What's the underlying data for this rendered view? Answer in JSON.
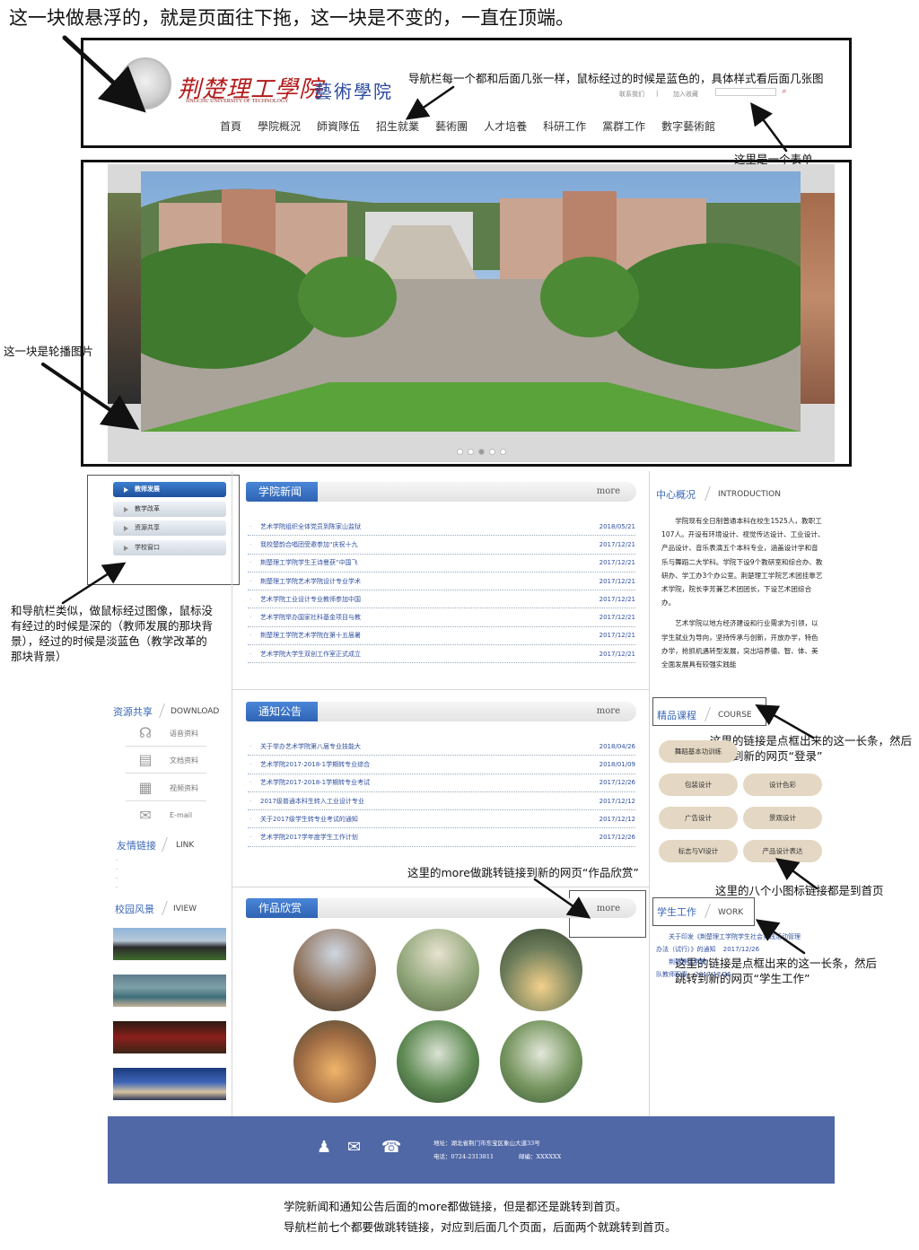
{
  "notes": {
    "top": "这一块做悬浮的，就是页面往下拖，这一块是不变的，一直在顶端。",
    "nav": "导航栏每一个都和后面几张一样，鼠标经过的时候是蓝色的，具体样式看后面几张图",
    "form": "这里是一个表单",
    "carousel": "这一块是轮播图片",
    "leftmenu": "和导航栏类似，做鼠标经过图像，鼠标没有经过的时候是深的（教师发展的那块背景），经过的时候是淡蓝色（教学改革的那块背景）",
    "course": "这里的链接是点框出来的这一长条，然后跳转到新的网页“登录”",
    "works": "这里的more做跳转链接到新的网页“作品欣赏”",
    "icons8": "这里的八个小图标链接都是到首页",
    "work": "这里的链接是点框出来的这一长条，然后跳转到新的网页“学生工作”",
    "bottom1": "学院新闻和通知公告后面的more都做链接，但是都还是跳转到首页。",
    "bottom2": "导航栏前七个都要做跳转链接，对应到后面几个页面，后面两个就跳转到首页。"
  },
  "header": {
    "logo_cn": "荆楚理工學院",
    "logo_en": "JINGCHU UNIVERSITY OF TECHNOLOGY",
    "school": "藝術學院",
    "link_contact": "联系我们",
    "link_fav": "加入收藏",
    "search_placeholder": ""
  },
  "nav": [
    "首頁",
    "學院概況",
    "師資隊伍",
    "招生就業",
    "藝術團",
    "人才培養",
    "科研工作",
    "黨群工作",
    "數字藝術館"
  ],
  "leftmenu": [
    "教师发展",
    "教学改革",
    "资源共享",
    "学校窗口"
  ],
  "news": {
    "title": "学院新闻",
    "more": "more",
    "items": [
      {
        "t": "艺术学院组织全体党员到陈家山监狱",
        "d": "2018/05/21"
      },
      {
        "t": "我校楚韵合唱团受邀参加“庆祝十九",
        "d": "2017/12/21"
      },
      {
        "t": "荆楚理工学院学生王诗曼获“中国飞",
        "d": "2017/12/21"
      },
      {
        "t": "荆楚理工学院艺术学院设计专业学术",
        "d": "2017/12/21"
      },
      {
        "t": "艺术学院工业设计专业教师参加中国",
        "d": "2017/12/21"
      },
      {
        "t": "艺术学院举办国家社科基金项目与教",
        "d": "2017/12/21"
      },
      {
        "t": "荆楚理工学院艺术学院在第十五届暑",
        "d": "2017/12/21"
      },
      {
        "t": "艺术学院大学生双创工作室正式成立",
        "d": "2017/12/21"
      }
    ]
  },
  "notice": {
    "title": "通知公告",
    "more": "more",
    "items": [
      {
        "t": "关于举办艺术学院第八届专业技能大",
        "d": "2018/04/26"
      },
      {
        "t": "艺术学院2017-2018-1学期转专业综合",
        "d": "2018/01/09"
      },
      {
        "t": "艺术学院2017-2018-1学期转专业考试",
        "d": "2017/12/26"
      },
      {
        "t": "2017级普通本科生转入工业设计专业",
        "d": "2017/12/12"
      },
      {
        "t": "关于2017级学生转专业考试的通知",
        "d": "2017/12/12"
      },
      {
        "t": "艺术学院2017学年度学生工作计划",
        "d": "2017/12/26"
      }
    ]
  },
  "works": {
    "title": "作品欣赏",
    "more": "more"
  },
  "center": {
    "title": "中心概况",
    "en": "INTRODUCTION",
    "p1": "学院现有全日制普通本科在校生1525人，教职工107人。开设有环境设计、视觉传达设计、工业设计、产品设计、音乐表演五个本科专业，涵盖设计学和音乐与舞蹈二大学科。学院下设9个教研室和综合办、教研办、学工办3个办公室。荆楚理工学院艺术团挂靠艺术学院，院长李芳兼艺术团团长，下设艺术团综合办。",
    "p2": "艺术学院以地方经济建设和行业需求为引领，以学生就业为导向，坚持传承与创新，开放办学，特色办学，抢抓机遇转型发展，突出培养德、智、体、美全面发展具有较强实践能"
  },
  "course": {
    "title": "精品课程",
    "en": "COURSE",
    "items": [
      "舞蹈基本功训练",
      "",
      "包装设计",
      "设计色彩",
      "广告设计",
      "景观设计",
      "标志与VI设计",
      "产品设计表达"
    ]
  },
  "work": {
    "title": "学生工作",
    "en": "WORK",
    "line1": "关于印发《荆楚理工学院学生社会实践活动管理",
    "line2": "办法（试行）》的通知",
    "date1": "2017/12/26",
    "line3": "荆楚理工学院",
    "line4": "队教师职责",
    "date2": "2017/12/26"
  },
  "download": {
    "title": "资源共享",
    "en": "DOWNLOAD",
    "items": [
      "语音资料",
      "文档资料",
      "视频资料",
      "E-mail"
    ]
  },
  "links": {
    "title": "友情链接",
    "en": "LINK"
  },
  "campus": {
    "title": "校园风景",
    "en": "IVIEW"
  },
  "footer": {
    "addr": "地址：湖北省荆门市东宝区象山大道33号",
    "tel": "电话：0724-2313811",
    "mail": "邮编：XXXXXX"
  }
}
